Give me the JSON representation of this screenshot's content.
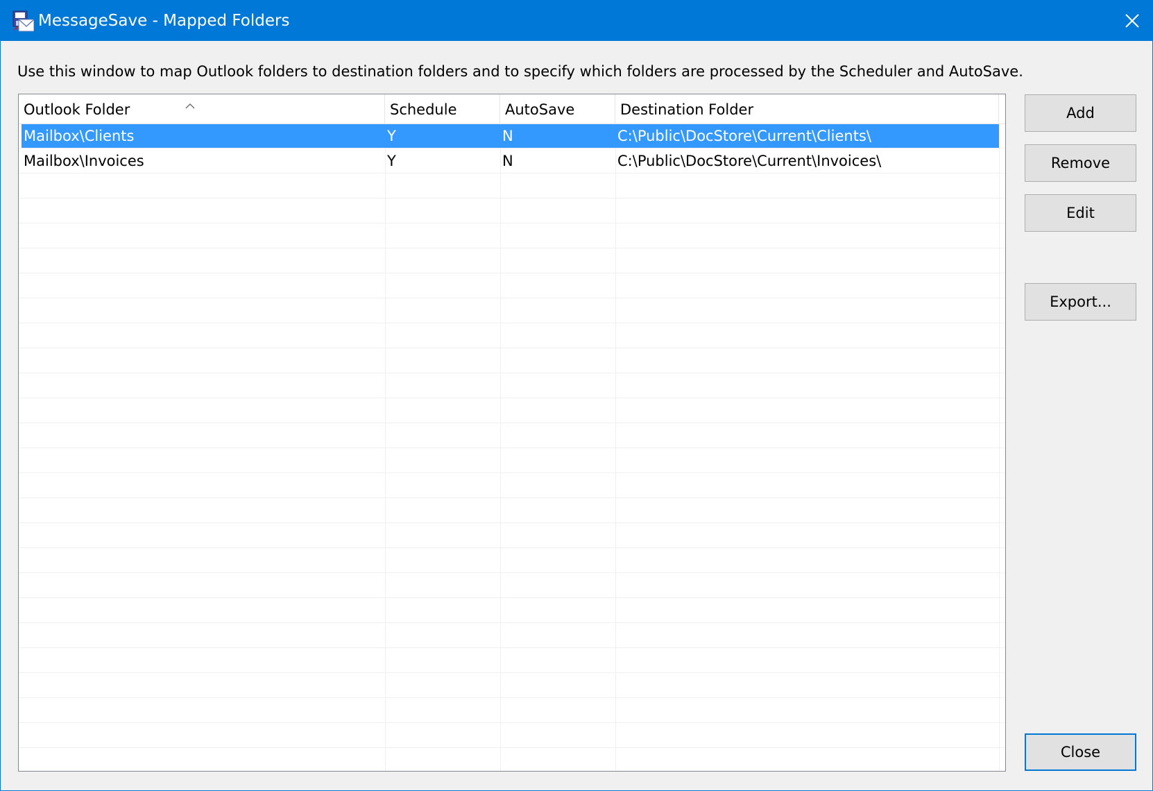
{
  "window": {
    "title": "MessageSave - Mapped Folders",
    "accent_color": "#0078d7",
    "app_icon": "messagesave-app-icon",
    "close_icon": "close-icon"
  },
  "instruction": "Use this window to map Outlook folders to destination folders and to specify which folders are processed by the Scheduler and AutoSave.",
  "list": {
    "sort_indicator": "^",
    "columns": [
      "Outlook Folder",
      "Schedule",
      "AutoSave",
      "Destination Folder"
    ],
    "rows": [
      {
        "outlook_folder": "Mailbox\\Clients",
        "schedule": "Y",
        "autosave": "N",
        "destination": "C:\\Public\\DocStore\\Current\\Clients\\",
        "selected": true
      },
      {
        "outlook_folder": "Mailbox\\Invoices",
        "schedule": "Y",
        "autosave": "N",
        "destination": "C:\\Public\\DocStore\\Current\\Invoices\\",
        "selected": false
      }
    ],
    "selection_color": "#3399ff"
  },
  "buttons": {
    "add": "Add",
    "remove": "Remove",
    "edit": "Edit",
    "export": "Export...",
    "close": "Close"
  }
}
